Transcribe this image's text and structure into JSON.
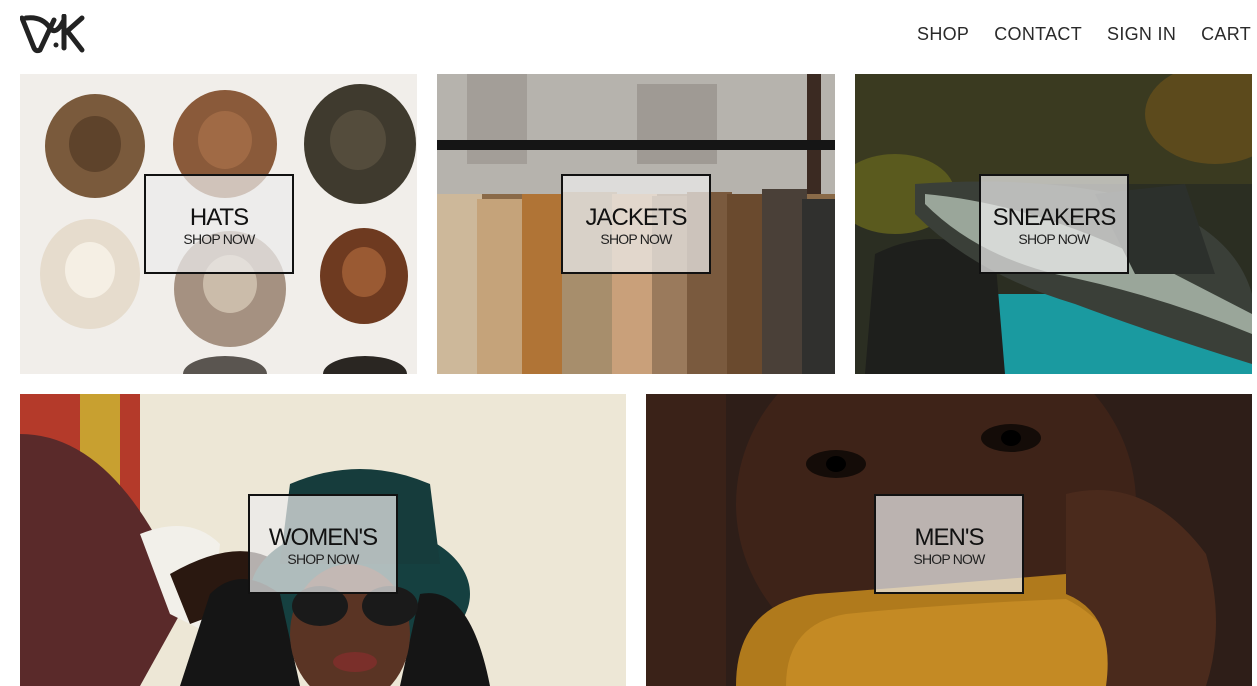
{
  "brand": {
    "logo_text": "VK"
  },
  "nav": {
    "items": [
      {
        "label": "SHOP"
      },
      {
        "label": "CONTACT"
      },
      {
        "label": "SIGN IN"
      },
      {
        "label": "CART"
      }
    ]
  },
  "categories": [
    {
      "title": "HATS",
      "cta": "SHOP NOW"
    },
    {
      "title": "JACKETS",
      "cta": "SHOP NOW"
    },
    {
      "title": "SNEAKERS",
      "cta": "SHOP NOW"
    },
    {
      "title": "WOMEN'S",
      "cta": "SHOP NOW"
    },
    {
      "title": "MEN'S",
      "cta": "SHOP NOW"
    }
  ]
}
